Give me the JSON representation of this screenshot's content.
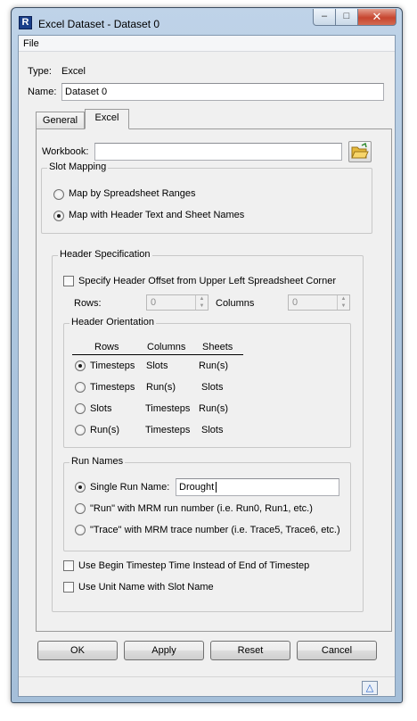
{
  "window": {
    "title": "Excel Dataset - Dataset 0",
    "app_icon_glyph": "R",
    "minimize_glyph": "–",
    "maximize_glyph": "□",
    "close_glyph": "✕"
  },
  "menu": {
    "file_label": "File"
  },
  "meta": {
    "type_label": "Type:",
    "type_value": "Excel",
    "name_label": "Name:",
    "name_value": "Dataset 0"
  },
  "tabs": [
    {
      "label": "General",
      "active": false
    },
    {
      "label": "Excel",
      "active": true
    }
  ],
  "workbook": {
    "label": "Workbook:",
    "value": ""
  },
  "slot_mapping": {
    "title": "Slot Mapping",
    "options": [
      {
        "label": "Map by Spreadsheet Ranges",
        "selected": false
      },
      {
        "label": "Map with Header Text and Sheet Names",
        "selected": true
      }
    ]
  },
  "header_spec": {
    "title": "Header Specification",
    "offset_label": "Specify Header Offset from Upper Left Spreadsheet Corner",
    "offset_checked": false,
    "rows_label": "Rows:",
    "rows_value": "0",
    "columns_label": "Columns",
    "columns_value": "0"
  },
  "header_orientation": {
    "title": "Header Orientation",
    "columns": [
      "Rows",
      "Columns",
      "Sheets"
    ],
    "rows": [
      {
        "cells": [
          "Timesteps",
          "Slots",
          "Run(s)"
        ],
        "selected": true
      },
      {
        "cells": [
          "Timesteps",
          "Run(s)",
          "Slots"
        ],
        "selected": false
      },
      {
        "cells": [
          "Slots",
          "Timesteps",
          "Run(s)"
        ],
        "selected": false
      },
      {
        "cells": [
          "Run(s)",
          "Timesteps",
          "Slots"
        ],
        "selected": false
      }
    ]
  },
  "run_names": {
    "title": "Run Names",
    "single_label": "Single Run Name:",
    "single_value": "Drought",
    "mrm_run_label": "\"Run\" with MRM run number (i.e. Run0, Run1, etc.)",
    "mrm_trace_label": "\"Trace\" with MRM trace number (i.e. Trace5, Trace6, etc.)",
    "selected": "single"
  },
  "options": {
    "begin_timestep_label": "Use Begin Timestep Time Instead of End of Timestep",
    "unit_name_label": "Use Unit Name with Slot Name"
  },
  "buttons": {
    "ok": "OK",
    "apply": "Apply",
    "reset": "Reset",
    "cancel": "Cancel"
  },
  "status": {
    "hint_glyph": "△"
  }
}
